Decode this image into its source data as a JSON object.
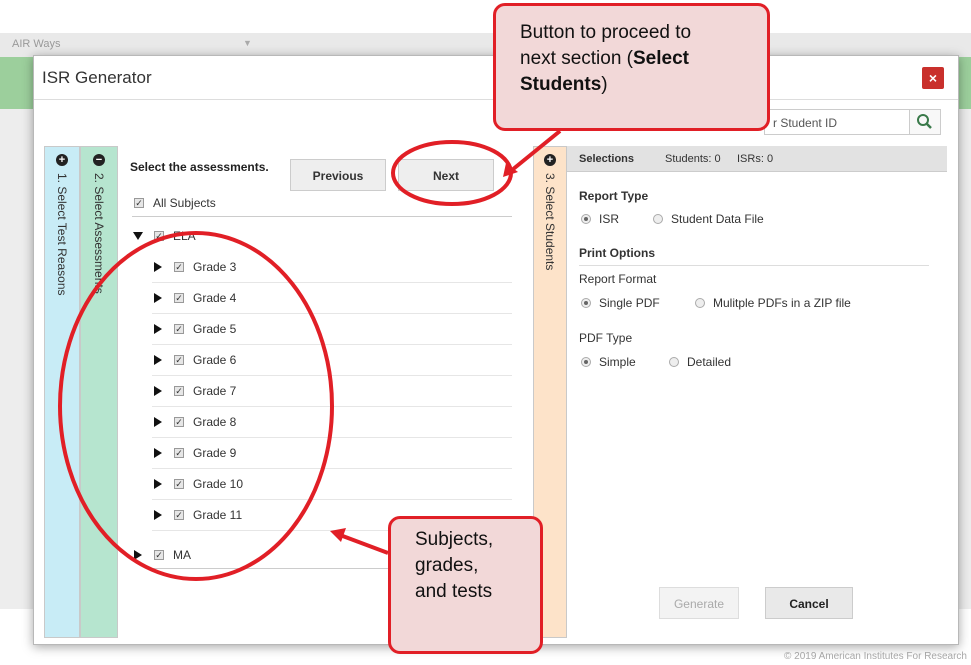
{
  "background_app": {
    "title": "AIR Ways",
    "copyright": "© 2019 American Institutes For Research"
  },
  "modal": {
    "title": "ISR Generator",
    "close_label": "×",
    "search_placeholder": "r Student ID"
  },
  "steps": [
    {
      "label": "1. Select Test Reasons",
      "icon": "plus-circle-icon"
    },
    {
      "label": "2. Select Assessments",
      "icon": "minus-circle-icon"
    },
    {
      "label": "3. Select Students",
      "icon": "plus-circle-icon"
    }
  ],
  "assessments": {
    "heading": "Select the assessments.",
    "previous_label": "Previous",
    "next_label": "Next",
    "all_subjects_label": "All Subjects",
    "subjects": [
      {
        "label": "ELA",
        "checked": true
      },
      {
        "label": "MA",
        "checked": true
      }
    ],
    "grades": [
      "Grade 3",
      "Grade 4",
      "Grade 5",
      "Grade 6",
      "Grade 7",
      "Grade 8",
      "Grade 9",
      "Grade 10",
      "Grade 11"
    ]
  },
  "selections": {
    "header_label": "Selections",
    "students_label": "Students: 0",
    "isrs_label": "ISRs: 0",
    "report_type_label": "Report Type",
    "report_type_options": [
      "ISR",
      "Student Data File"
    ],
    "print_options_label": "Print Options",
    "report_format_label": "Report Format",
    "report_format_options": [
      "Single PDF",
      "Mulitple PDFs in a ZIP file"
    ],
    "pdf_type_label": "PDF Type",
    "pdf_type_options": [
      "Simple",
      "Detailed"
    ],
    "generate_label": "Generate",
    "cancel_label": "Cancel"
  },
  "annotations": {
    "callout_next_line1": "Button to proceed to",
    "callout_next_line2_a": "next section (",
    "callout_next_line2_b": "Select",
    "callout_next_line3_a": "Students",
    "callout_next_line3_b": ")",
    "callout_subjects_line1": "Subjects,",
    "callout_subjects_line2": "grades,",
    "callout_subjects_line3": "and tests",
    "color": "#e11f26"
  }
}
